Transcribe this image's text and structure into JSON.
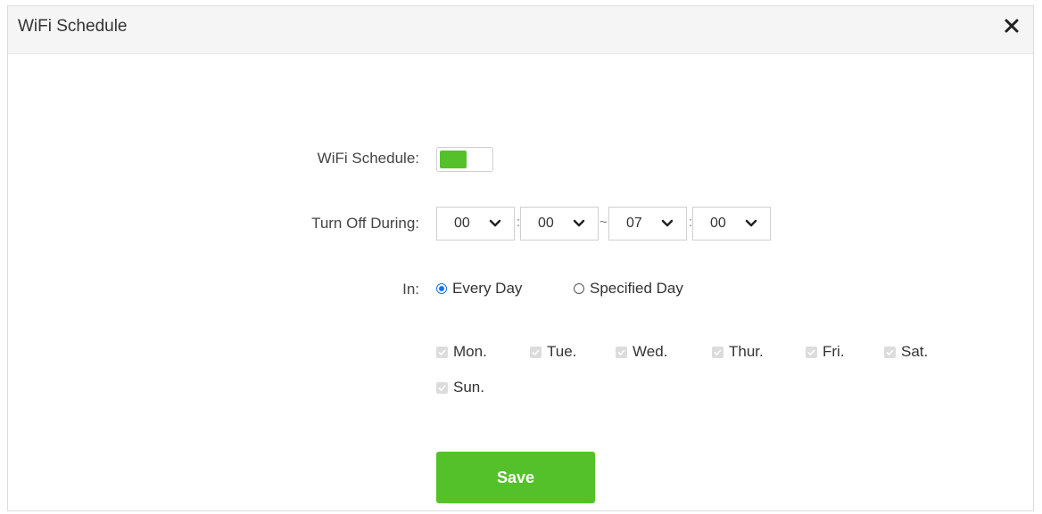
{
  "dialog": {
    "title": "WiFi Schedule"
  },
  "form": {
    "schedule_label": "WiFi Schedule:",
    "schedule_enabled": true,
    "turn_off_label": "Turn Off During:",
    "start_hour": "00",
    "start_minute": "00",
    "end_hour": "07",
    "end_minute": "00",
    "colon": ":",
    "tilde": "~",
    "in_label": "In:",
    "radio_every_day": "Every Day",
    "radio_specified_day": "Specified Day",
    "selected_radio": "Every Day",
    "days": [
      "Mon.",
      "Tue.",
      "Wed.",
      "Thur.",
      "Fri.",
      "Sat.",
      "Sun."
    ],
    "save_label": "Save"
  },
  "colors": {
    "accent_green": "#54c12a",
    "radio_blue": "#1a73e8",
    "checkbox_disabled": "#dcdcdc"
  },
  "icons": {
    "close": "close-icon",
    "dropdown": "chevron-down-icon",
    "check": "check-icon"
  }
}
